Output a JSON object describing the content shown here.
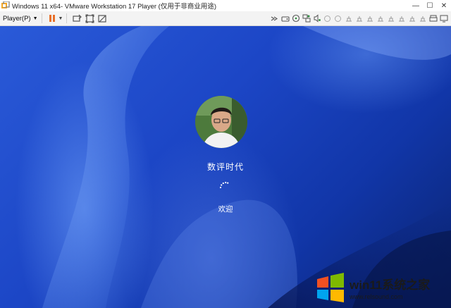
{
  "window": {
    "title": "Windows 11 x64- VMware Workstation 17 Player (仅用于非商业用途)",
    "controls": {
      "minimize": "—",
      "maximize": "☐",
      "close": "✕"
    }
  },
  "toolbar": {
    "player_menu": "Player(P)",
    "left_icons": [
      "pause-icon",
      "send-ctrl-alt-del-icon",
      "fit-guest-icon",
      "unity-icon"
    ],
    "right_icons": [
      "expand-icon",
      "hard-disk-icon",
      "cd-dvd-icon",
      "network-icon",
      "audio-icon",
      "usb-icon",
      "printer-icon",
      "display-icon"
    ]
  },
  "guest_screen": {
    "user_name": "数评时代",
    "status": "欢迎",
    "colors": {
      "background": "#1c46c6",
      "text": "#ffffff"
    }
  },
  "watermark": {
    "title": "win11系统之家",
    "url": "www.relsound.com"
  }
}
